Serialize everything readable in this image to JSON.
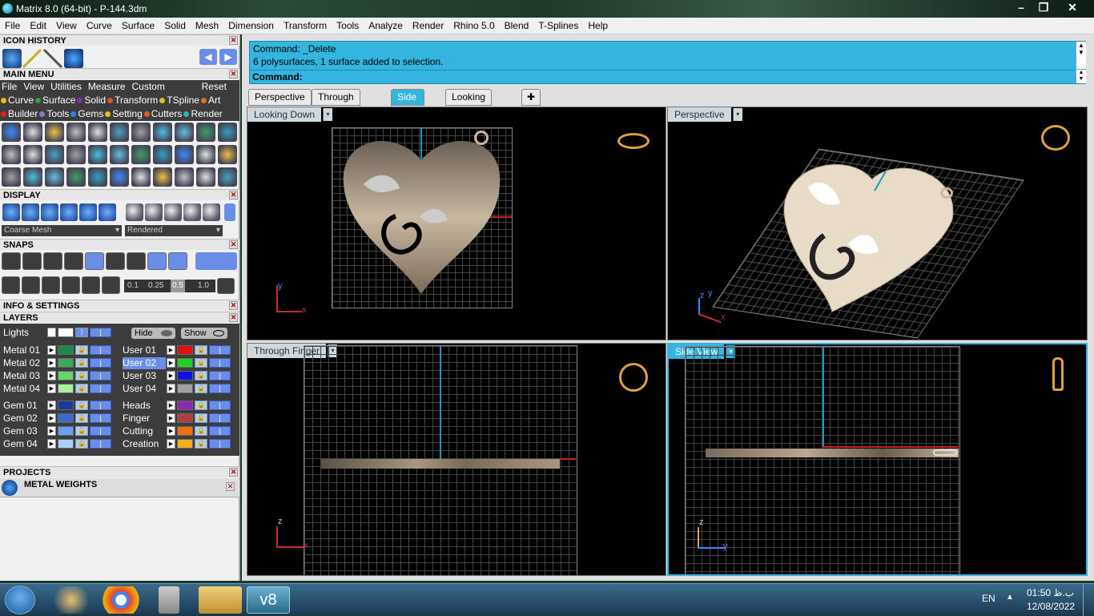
{
  "window": {
    "title": "Matrix 8.0 (64-bit) - P-144.3dm"
  },
  "menu": [
    "File",
    "Edit",
    "View",
    "Curve",
    "Surface",
    "Solid",
    "Mesh",
    "Dimension",
    "Transform",
    "Tools",
    "Analyze",
    "Render",
    "Rhino 5.0",
    "Blend",
    "T-Splines",
    "Help"
  ],
  "icon_history": {
    "title": "ICON HISTORY"
  },
  "main_menu": {
    "title": "MAIN MENU",
    "items": [
      "File",
      "View",
      "Utilities",
      "Measure",
      "Custom"
    ],
    "reset": "Reset",
    "row1": [
      {
        "label": "Curve",
        "color": "#e0c020"
      },
      {
        "label": "Surface",
        "color": "#30a040"
      },
      {
        "label": "Solid",
        "color": "#8030c0"
      },
      {
        "label": "Transform",
        "color": "#e05020"
      },
      {
        "label": "TSpline",
        "color": "#e0c020"
      },
      {
        "label": "Art",
        "color": "#e07020"
      }
    ],
    "row2": [
      {
        "label": "Builder",
        "color": "#e02020"
      },
      {
        "label": "Tools",
        "color": "#8080c0"
      },
      {
        "label": "Gems",
        "color": "#3080e0"
      },
      {
        "label": "Setting",
        "color": "#e0c020"
      },
      {
        "label": "Cutters",
        "color": "#e06020"
      },
      {
        "label": "Render",
        "color": "#30b0b0"
      }
    ]
  },
  "display": {
    "title": "DISPLAY",
    "mesh_select": "Coarse Mesh",
    "render_select": "Rendered"
  },
  "snaps": {
    "title": "SNAPS",
    "steps": [
      "0.1",
      "0.25",
      "0.5",
      "1.0"
    ]
  },
  "info": {
    "title": "INFO & SETTINGS"
  },
  "layers": {
    "title": "LAYERS",
    "lights": "Lights",
    "hide": "Hide",
    "show": "Show",
    "left": [
      {
        "name": "Metal 01",
        "color": "#1e8a4a"
      },
      {
        "name": "Metal 02",
        "color": "#3aaa5a"
      },
      {
        "name": "Metal 03",
        "color": "#6ad46a"
      },
      {
        "name": "Metal 04",
        "color": "#a8f0a0"
      },
      {
        "name": "Gem 01",
        "color": "#1a3aa0"
      },
      {
        "name": "Gem 02",
        "color": "#3a6ad0"
      },
      {
        "name": "Gem 03",
        "color": "#6aa0f0"
      },
      {
        "name": "Gem 04",
        "color": "#a8d0f8"
      }
    ],
    "right": [
      {
        "name": "User 01",
        "color": "#e01010"
      },
      {
        "name": "User 02",
        "color": "#20d020",
        "selected": true
      },
      {
        "name": "User 03",
        "color": "#1010e0"
      },
      {
        "name": "User 04",
        "color": "#a0a0a0"
      },
      {
        "name": "Heads",
        "color": "#8a2ab0"
      },
      {
        "name": "Finger",
        "color": "#b04040"
      },
      {
        "name": "Cutting",
        "color": "#f07010"
      },
      {
        "name": "Creation",
        "color": "#f0b020"
      }
    ]
  },
  "projects": {
    "title": "PROJECTS",
    "metal_weights": "METAL WEIGHTS"
  },
  "command": {
    "line1": "Command: _Delete",
    "line2": "6 polysurfaces, 1 surface added to selection.",
    "prompt": "Command:"
  },
  "tabs": [
    {
      "label": "Perspective"
    },
    {
      "label": "Through Finger"
    },
    {
      "label": "Side View",
      "active": true
    },
    {
      "label": "Looking Down"
    }
  ],
  "viewports": [
    {
      "label": "Looking Down",
      "axes": [
        "y",
        "x"
      ]
    },
    {
      "label": "Perspective",
      "axes": [
        "z",
        "y",
        "x"
      ]
    },
    {
      "label": "Through Finger",
      "axes": [
        "z",
        "x"
      ]
    },
    {
      "label": "Side View",
      "axes": [
        "z",
        "y"
      ],
      "active": true
    }
  ],
  "taskbar": {
    "lang": "EN",
    "time": "01:50 ب.ظ",
    "date": "12/08/2022"
  }
}
